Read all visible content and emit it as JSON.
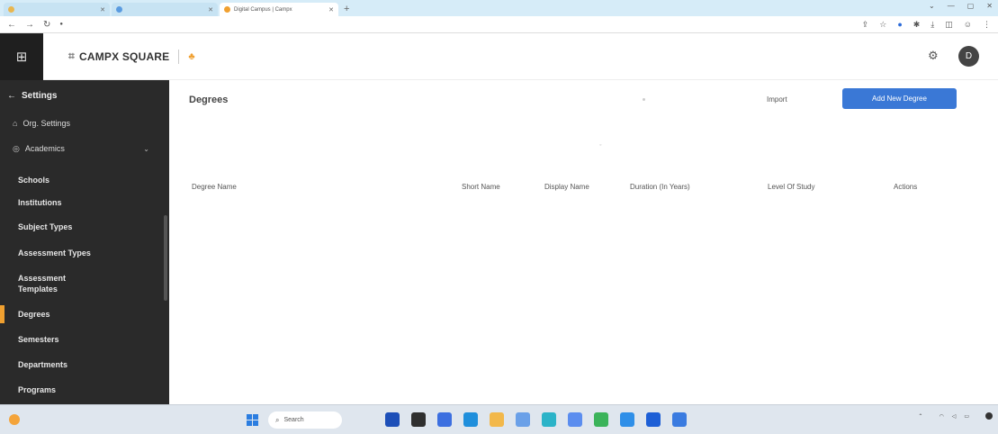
{
  "browser": {
    "tabs": [
      {
        "title": "",
        "active": false
      },
      {
        "title": "",
        "active": false
      },
      {
        "title": "Digital Campus | Campx",
        "active": true
      }
    ],
    "url": ""
  },
  "header": {
    "brand": "CAMPX SQUARE",
    "avatar_initial": "D"
  },
  "sidebar": {
    "back_label": "Settings",
    "org_settings": "Org. Settings",
    "academics": "Academics",
    "subitems": [
      {
        "label": "Schools"
      },
      {
        "label": "Institutions"
      },
      {
        "label": "Subject Types"
      },
      {
        "label": "Assessment Types"
      },
      {
        "label": "Assessment Templates"
      },
      {
        "label": "Degrees"
      },
      {
        "label": "Semesters"
      },
      {
        "label": "Departments"
      },
      {
        "label": "Programs"
      }
    ],
    "active_index": 5
  },
  "main": {
    "title": "Degrees",
    "import_label": "Import",
    "add_label": "Add New Degree",
    "table": {
      "headers": [
        "Degree Name",
        "Short Name",
        "Display Name",
        "Duration (In Years)",
        "Level Of Study",
        "Actions"
      ],
      "rows": []
    }
  },
  "taskbar": {
    "search_label": "Search",
    "app_colors": [
      "#1d4fb8",
      "#2f2f2f",
      "#3c6fe0",
      "#1f8fdc",
      "#f2b84b",
      "#6aa0e8",
      "#2bb3c8",
      "#5b8def",
      "#3bb35a",
      "#2f8fe8",
      "#1d5fd6",
      "#3a7be0"
    ]
  },
  "colors": {
    "accent": "#3a78d6",
    "sidebar_bg": "#2a2a2a",
    "active_marker": "#f0a030"
  }
}
